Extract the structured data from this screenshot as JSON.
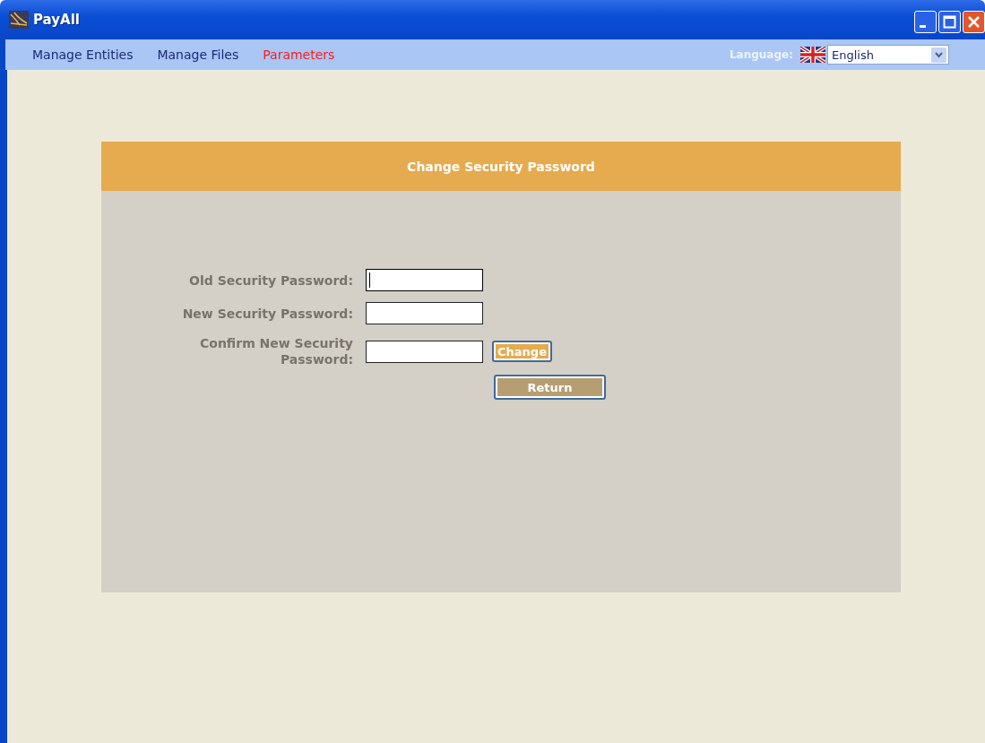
{
  "window": {
    "title": "PayAll"
  },
  "menu": [
    {
      "label": "Manage Entities",
      "selected": false
    },
    {
      "label": "Manage Files",
      "selected": false
    },
    {
      "label": "Parameters",
      "selected": true
    }
  ],
  "language": {
    "label": "Language:",
    "value": "English"
  },
  "panel": {
    "title": "Change Security Password",
    "fields": [
      {
        "label": "Old Security Password:",
        "focused": true
      },
      {
        "label": "New Security Password:",
        "focused": false
      },
      {
        "label": "Confirm New Security Password:",
        "focused": false
      }
    ],
    "buttons": [
      {
        "label": "Change",
        "kind": "primary"
      },
      {
        "label": "Return",
        "kind": "secondary"
      }
    ]
  }
}
